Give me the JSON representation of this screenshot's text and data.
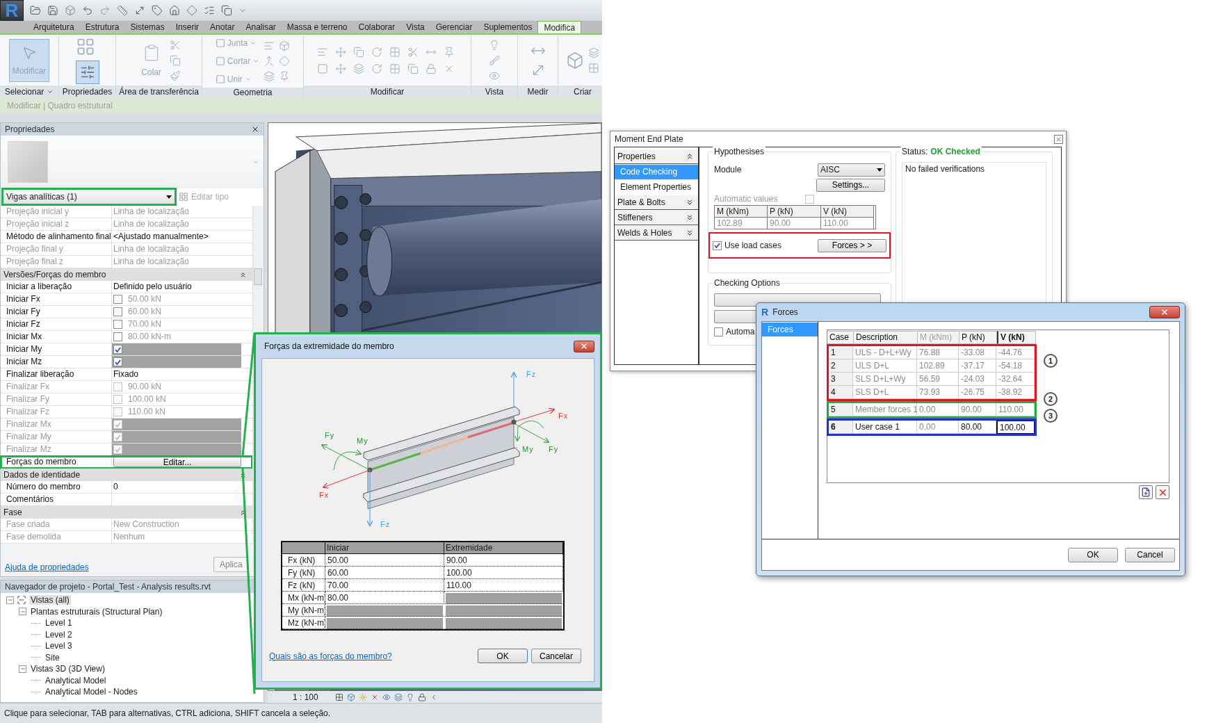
{
  "revit": {
    "logo": "R",
    "ribbon_tabs": [
      {
        "label": "Arquitetura",
        "selected": false
      },
      {
        "label": "Estrutura",
        "selected": false
      },
      {
        "label": "Sistemas",
        "selected": false
      },
      {
        "label": "Inserir",
        "selected": false
      },
      {
        "label": "Anotar",
        "selected": false
      },
      {
        "label": "Analisar",
        "selected": false
      },
      {
        "label": "Massa e terreno",
        "selected": false
      },
      {
        "label": "Colaborar",
        "selected": false
      },
      {
        "label": "Vista",
        "selected": false
      },
      {
        "label": "Gerenciar",
        "selected": false
      },
      {
        "label": "Suplementos",
        "selected": false
      },
      {
        "label": "Modifica",
        "selected": true
      }
    ],
    "ribbon_panels": [
      {
        "title": "Selecionar",
        "kind": "select",
        "menu": true,
        "tools": [
          {
            "label": "Modificar",
            "selected": true
          }
        ]
      },
      {
        "title": "Propriedades",
        "kind": "properties",
        "menu": false,
        "active": true
      },
      {
        "title": "Área de transferência",
        "kind": "clipboard",
        "menu": false,
        "tools": [
          {
            "label": "Colar",
            "selected": false
          }
        ]
      },
      {
        "title": "Geometria",
        "kind": "geometry",
        "menu": false,
        "tools": [
          {
            "label": "Junta",
            "selected": false
          },
          {
            "label": "Cortar",
            "selected": false
          },
          {
            "label": "Unir",
            "selected": false
          }
        ]
      },
      {
        "title": "Modificar",
        "kind": "modify",
        "menu": false
      },
      {
        "title": "Vista",
        "kind": "view",
        "menu": false
      },
      {
        "title": "Medir",
        "kind": "measure",
        "menu": false
      },
      {
        "title": "Criar",
        "kind": "create",
        "menu": false
      }
    ],
    "options_bar": "Modificar | Quadro estrutural",
    "properties": {
      "title": "Propriedades",
      "type_selector": {
        "value": "Vigas analíticas (1)",
        "highlighted": true
      },
      "edit_type": "Editar tipo",
      "rows": [
        {
          "kind": "text",
          "label": "Projeção inicial y",
          "value": "Linha de localização",
          "disabled": true
        },
        {
          "kind": "text",
          "label": "Projeção inicial z",
          "value": "Linha de localização",
          "disabled": true
        },
        {
          "kind": "text",
          "label": "Método de alinhamento final",
          "value": "<Ajustado manualmente>",
          "disabled": false
        },
        {
          "kind": "text",
          "label": "Projeção final y",
          "value": "Linha de localização",
          "disabled": true
        },
        {
          "kind": "text",
          "label": "Projeção final z",
          "value": "Linha de localização",
          "disabled": true
        },
        {
          "kind": "group",
          "label": "Versões/Forças do membro",
          "expanded": true
        },
        {
          "kind": "text",
          "label": "Iniciar a liberação",
          "value": "Definido pelo usuário",
          "disabled": false
        },
        {
          "kind": "check",
          "label": "Iniciar Fx",
          "value": "50.00 kN",
          "disabled": false,
          "checked": false,
          "shaded": false
        },
        {
          "kind": "check",
          "label": "Iniciar Fy",
          "value": "60.00 kN",
          "disabled": false,
          "checked": false,
          "shaded": false
        },
        {
          "kind": "check",
          "label": "Iniciar Fz",
          "value": "70.00 kN",
          "disabled": false,
          "checked": false,
          "shaded": false
        },
        {
          "kind": "check",
          "label": "Iniciar Mx",
          "value": "80.00 kN-m",
          "disabled": false,
          "checked": false,
          "shaded": false
        },
        {
          "kind": "check",
          "label": "Iniciar My",
          "disabled": false,
          "checked": true,
          "shaded": true
        },
        {
          "kind": "check",
          "label": "Iniciar Mz",
          "disabled": false,
          "checked": true,
          "shaded": true
        },
        {
          "kind": "text",
          "label": "Finalizar liberação",
          "value": "Fixado",
          "disabled": false
        },
        {
          "kind": "check",
          "label": "Finalizar Fx",
          "value": "90.00 kN",
          "disabled": true,
          "checked": false,
          "shaded": false
        },
        {
          "kind": "check",
          "label": "Finalizar Fy",
          "value": "100.00 kN",
          "disabled": true,
          "checked": false,
          "shaded": false
        },
        {
          "kind": "check",
          "label": "Finalizar Fz",
          "value": "110.00 kN",
          "disabled": true,
          "checked": false,
          "shaded": false
        },
        {
          "kind": "check",
          "label": "Finalizar Mx",
          "disabled": true,
          "checked": true,
          "shaded": true
        },
        {
          "kind": "check",
          "label": "Finalizar My",
          "disabled": true,
          "checked": true,
          "shaded": true
        },
        {
          "kind": "check",
          "label": "Finalizar Mz",
          "disabled": true,
          "checked": true,
          "shaded": true
        },
        {
          "kind": "button",
          "label": "Forças do membro",
          "value": "Editar...",
          "disabled": false,
          "highlighted": true
        },
        {
          "kind": "group",
          "label": "Dados de identidade",
          "expanded": true
        },
        {
          "kind": "text",
          "label": "Número do membro",
          "value": "0",
          "disabled": false
        },
        {
          "kind": "text",
          "label": "Comentários",
          "disabled": false
        },
        {
          "kind": "group",
          "label": "Fase",
          "expanded": true
        },
        {
          "kind": "text",
          "label": "Fase criada",
          "value": "New Construction",
          "disabled": true
        },
        {
          "kind": "text",
          "label": "Fase demolida",
          "value": "Nenhum",
          "disabled": true
        }
      ],
      "help_link": "Ajuda de propriedades",
      "apply": "Aplica"
    },
    "browser": {
      "title": "Navegador de projeto - Portal_Test - Analysis results.rvt",
      "tree": [
        {
          "label": "Vistas (all)",
          "expanded": true,
          "selected": true,
          "children": [
            {
              "label": "Plantas estruturais (Structural Plan)",
              "expanded": true,
              "selected": false,
              "children": [
                {
                  "label": "Level 1",
                  "selected": false
                },
                {
                  "label": "Level 2",
                  "selected": false
                },
                {
                  "label": "Level 3",
                  "selected": false
                },
                {
                  "label": "Site",
                  "selected": false
                }
              ]
            },
            {
              "label": "Vistas 3D (3D View)",
              "expanded": true,
              "selected": false,
              "children": [
                {
                  "label": "Analytical Model",
                  "selected": false
                },
                {
                  "label": "Analytical Model - Nodes",
                  "selected": false
                }
              ]
            }
          ]
        }
      ]
    },
    "view_scale": "1 : 100",
    "status_bar": "Clique para selecionar, TAB para alternativas, CTRL adiciona, SHIFT cancela a seleção.",
    "member_forces_dialog": {
      "title": "Forças da extremidade do membro",
      "highlighted": true,
      "diagram_labels": [
        "Fz",
        "Fx",
        "Fy",
        "My",
        "My",
        "Fy",
        "Fx",
        "Fz"
      ],
      "columns": [
        "Iniciar",
        "Extremidade"
      ],
      "rows": [
        {
          "label": "Fx (kN)",
          "start": "50.00",
          "end": "90.00",
          "start_disabled": false,
          "end_disabled": false
        },
        {
          "label": "Fy (kN)",
          "start": "60.00",
          "end": "100.00",
          "start_disabled": false,
          "end_disabled": false
        },
        {
          "label": "Fz (kN)",
          "start": "70.00",
          "end": "110.00",
          "start_disabled": false,
          "end_disabled": false
        },
        {
          "label": "Mx (kN-m)",
          "start": "80.00",
          "start_disabled": false,
          "end_disabled": true
        },
        {
          "label": "My (kN-m)",
          "start_disabled": true,
          "end_disabled": true
        },
        {
          "label": "Mz (kN-m)",
          "start_disabled": true,
          "end_disabled": true
        }
      ],
      "help_link": "Quais são as forças do membro?",
      "buttons": [
        "OK",
        "Cancelar"
      ]
    }
  },
  "moment_end_plate": {
    "title": "Moment End Plate",
    "nav": [
      {
        "label": "Properties",
        "kind": "header",
        "expanded": true,
        "selected": false
      },
      {
        "label": "Code Checking",
        "kind": "item",
        "selected": true
      },
      {
        "label": "Element Properties",
        "kind": "item",
        "selected": false
      },
      {
        "label": "Plate & Bolts",
        "kind": "header",
        "expanded": false,
        "selected": false
      },
      {
        "label": "Stiffeners",
        "kind": "header",
        "expanded": false,
        "selected": false
      },
      {
        "label": "Welds & Holes",
        "kind": "header",
        "expanded": false,
        "selected": false
      }
    ],
    "hypotheses": {
      "title": "Hypothesises",
      "module_label": "Module",
      "module": "AISC",
      "settings": "Settings...",
      "automatic_values": {
        "label": "Automatic values",
        "checked": false
      },
      "columns": [
        "M (kNm)",
        "P (kN)",
        "V (kN)"
      ],
      "values": [
        "102.89",
        "90.00",
        "110.00"
      ],
      "use_load_cases": {
        "label": "Use load cases",
        "checked": true,
        "highlighted": true
      },
      "forces_button": "Forces > >"
    },
    "checking_options": {
      "title": "Checking Options",
      "automatic": {
        "label": "Automa",
        "checked": false
      }
    },
    "status": {
      "label": "Status:",
      "value": "OK Checked",
      "message": "No failed verifications"
    }
  },
  "forces_dialog": {
    "logo": "R",
    "title": "Forces",
    "nav": [
      {
        "label": "Forces",
        "selected": true
      }
    ],
    "columns": [
      {
        "label": "Case",
        "disabled": false,
        "active": false
      },
      {
        "label": "Description",
        "disabled": false,
        "active": false
      },
      {
        "label": "M (kNm)",
        "disabled": true,
        "active": false
      },
      {
        "label": "P (kN)",
        "disabled": false,
        "active": false
      },
      {
        "label": "V (kN)",
        "disabled": false,
        "active": true
      }
    ],
    "row_groups": [
      {
        "marker": "1",
        "color": "#e0141e",
        "rows": [
          {
            "case": "1",
            "description": "ULS - D+L+Wy",
            "m": "76.88",
            "p": "-33.08",
            "v": "-44.76",
            "editable": false,
            "selected": false
          },
          {
            "case": "2",
            "description": "ULS D+L",
            "m": "102.89",
            "p": "-37.17",
            "v": "-54.18",
            "editable": false,
            "selected": false
          },
          {
            "case": "3",
            "description": "SLS D+L+Wy",
            "m": "56.59",
            "p": "-24.03",
            "v": "-32.64",
            "editable": false,
            "selected": false
          },
          {
            "case": "4",
            "description": "SLS D+L",
            "m": "73.93",
            "p": "-26.75",
            "v": "-38.92",
            "editable": false,
            "selected": false
          }
        ]
      },
      {
        "marker": "2",
        "color": "#1fae3c",
        "rows": [
          {
            "case": "5",
            "description": "Member forces 1",
            "m": "0.00",
            "p": "90.00",
            "v": "110.00",
            "editable": false,
            "selected": false
          }
        ]
      },
      {
        "marker": "3",
        "color": "#2230c8",
        "rows": [
          {
            "case": "6",
            "description": "User case 1",
            "m": "0.00",
            "p": "80.00",
            "v": "100.00",
            "editable": true,
            "selected": true
          }
        ]
      }
    ],
    "buttons": [
      "OK",
      "Cancel"
    ]
  }
}
